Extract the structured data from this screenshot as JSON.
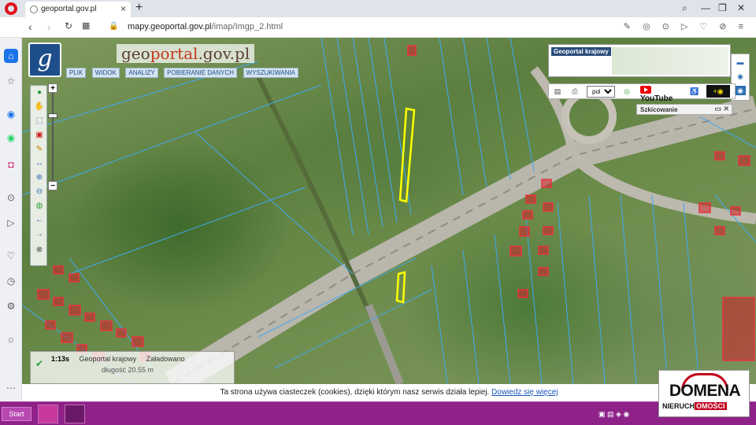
{
  "browser": {
    "tab_title": "geoportal.gov.pl",
    "url_host": "mapy.geoportal.gov.pl",
    "url_path": "/imap/Imgp_2.html"
  },
  "geoportal": {
    "logo_letter": "g",
    "title_geo": "geo",
    "title_portal": "portal",
    "title_domain": ".gov.pl",
    "menu": [
      "PLIK",
      "WIDOK",
      "ANALIZY",
      "POBIERANIE DANYCH",
      "WYSZUKIWANIA"
    ],
    "overview_label": "Geoportal krajowy",
    "language": "pol",
    "youtube_label": "YouTube",
    "sketch_label": "Szkicowanie",
    "status_time": "1:13s",
    "status_layer": "Geoportal krajowy",
    "status_state": "Załadowano",
    "status_line2": "długość 20.55 m"
  },
  "cookie": {
    "text": "Ta strona używa ciasteczek (cookies), dzięki którym nasz serwis działa lepiej.",
    "link": "Dowiedz się więcej"
  },
  "taskbar": {
    "start": "Start"
  },
  "brand": {
    "line1": "DOMENA",
    "line2_a": "NIERUCH",
    "line2_b": "OMOŚCI"
  },
  "colors": {
    "parcel_lines": "#3fa9f5",
    "highlight_parcels": "#ffff00",
    "buildings": "#d41f2a",
    "taskbar": "#8e2288"
  },
  "icons": {
    "sidebar": [
      "home-icon",
      "speed-dial-icon",
      "messenger-icon",
      "whatsapp-icon",
      "instagram-icon",
      "player-icon",
      "send-icon",
      "heart-icon",
      "history-icon",
      "settings-icon",
      "lightbulb-icon",
      "more-icon"
    ]
  }
}
